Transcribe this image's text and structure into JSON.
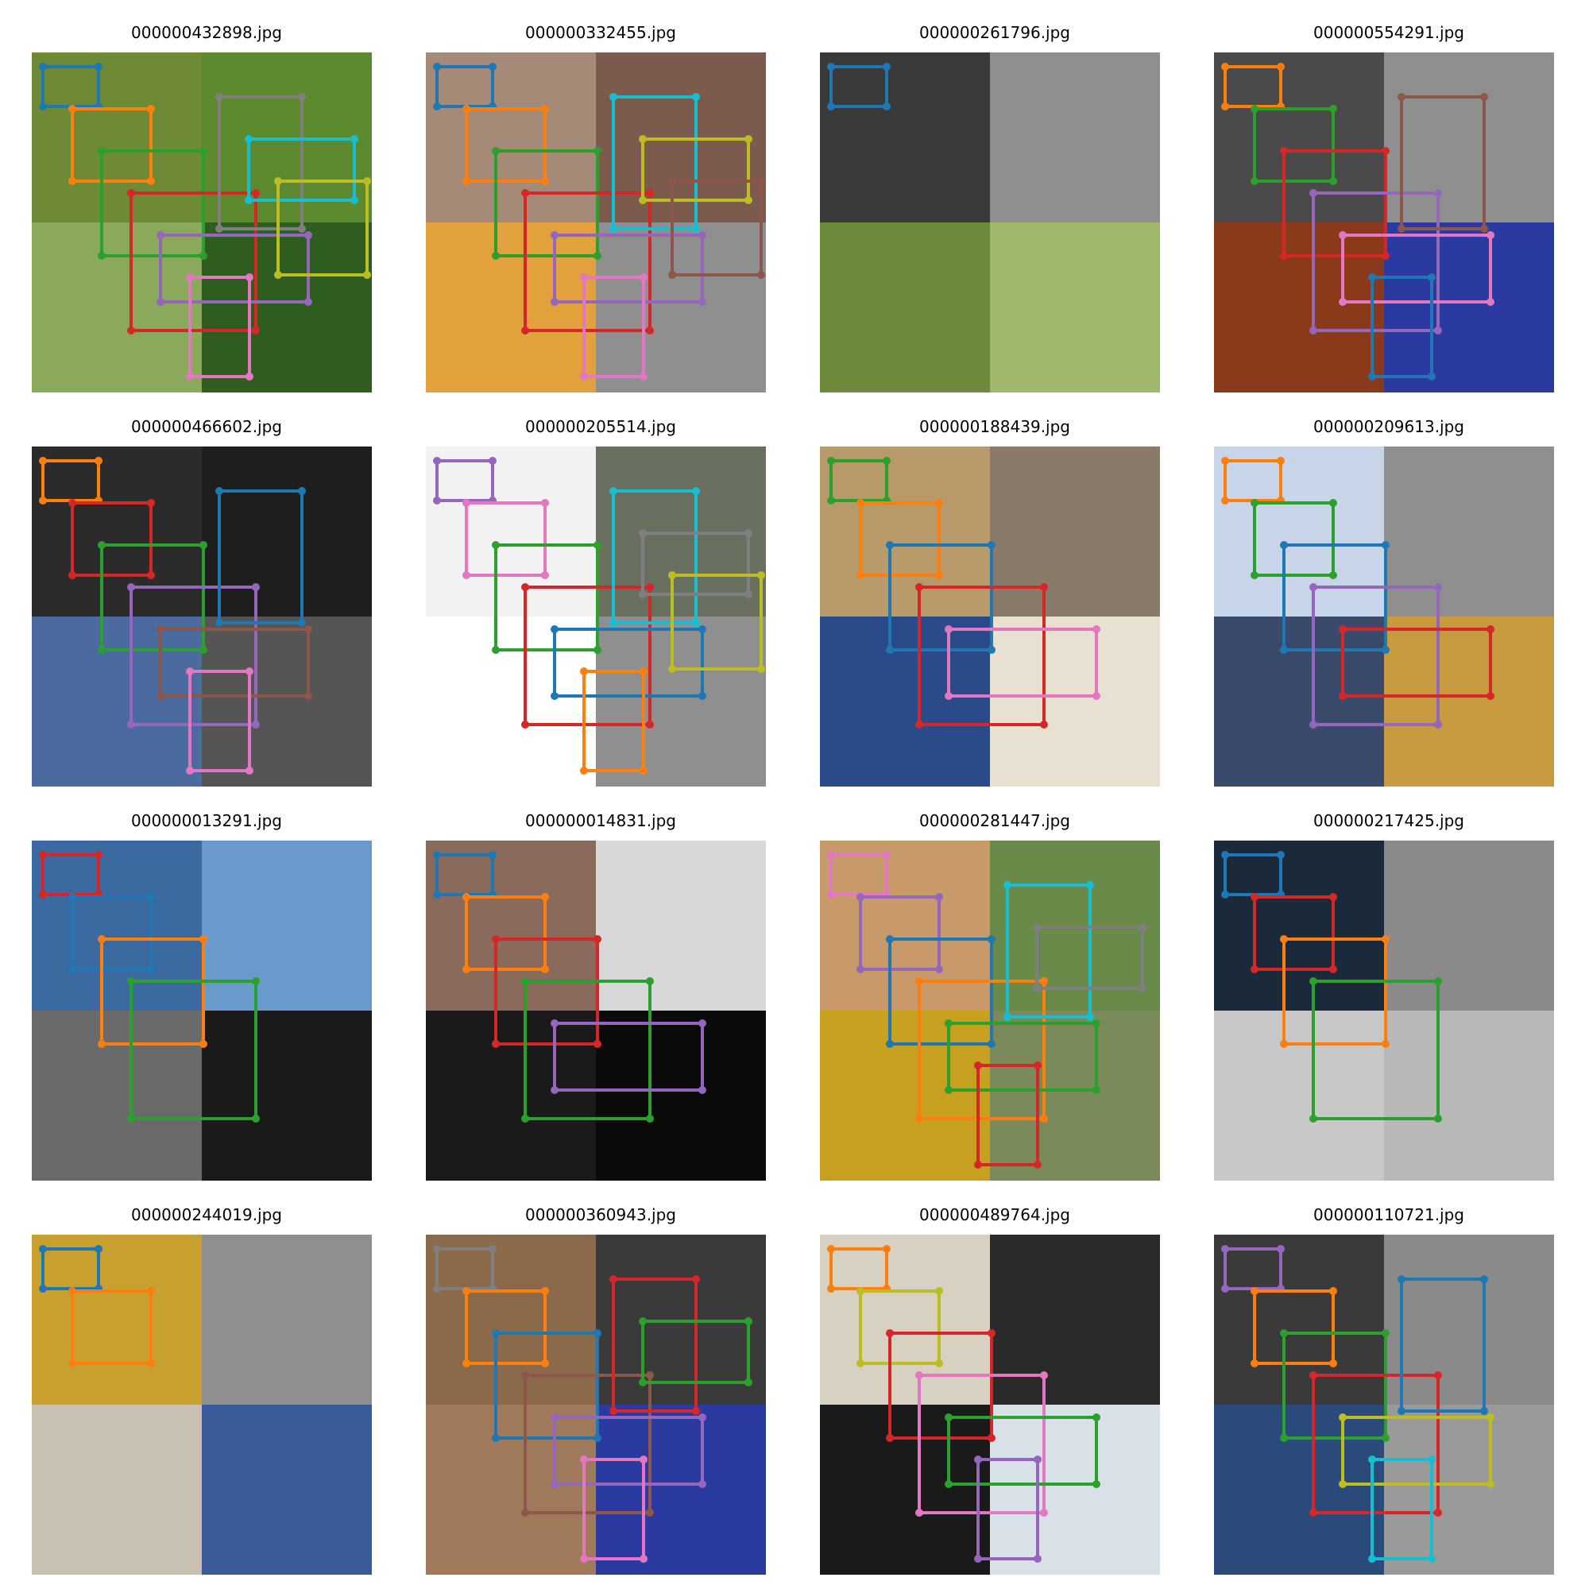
{
  "grid": {
    "images": [
      {
        "title": "000000432898.jpg",
        "tiles": [
          "#6f8a35",
          "#5d8a2e",
          "#8aa95a",
          "#2f5c1f"
        ],
        "boxes": [
          {
            "color": "#1f77b4"
          },
          {
            "color": "#ff7f0e"
          },
          {
            "color": "#2ca02c"
          },
          {
            "color": "#d62728"
          },
          {
            "color": "#9467bd"
          },
          {
            "color": "#e377c2"
          },
          {
            "color": "#7f7f7f"
          },
          {
            "color": "#17becf"
          },
          {
            "color": "#bcbd22"
          }
        ]
      },
      {
        "title": "000000332455.jpg",
        "tiles": [
          "#a58b77",
          "#7c5b4e",
          "#e2a13c",
          "#8f8f8f"
        ],
        "boxes": [
          {
            "color": "#1f77b4"
          },
          {
            "color": "#ff7f0e"
          },
          {
            "color": "#2ca02c"
          },
          {
            "color": "#d62728"
          },
          {
            "color": "#9467bd"
          },
          {
            "color": "#e377c2"
          },
          {
            "color": "#17becf"
          },
          {
            "color": "#bcbd22"
          },
          {
            "color": "#8c564b"
          }
        ]
      },
      {
        "title": "000000261796.jpg",
        "tiles": [
          "#3a3a3a",
          "#8f8f8f",
          "#6c8a3a",
          "#a0b86a"
        ],
        "boxes": [
          {
            "color": "#1f77b4"
          }
        ]
      },
      {
        "title": "000000554291.jpg",
        "tiles": [
          "#4a4a4a",
          "#8f8f8f",
          "#8a3a1a",
          "#2a3aa0"
        ],
        "boxes": [
          {
            "color": "#ff7f0e"
          },
          {
            "color": "#2ca02c"
          },
          {
            "color": "#d62728"
          },
          {
            "color": "#9467bd"
          },
          {
            "color": "#e377c2"
          },
          {
            "color": "#1f77b4"
          },
          {
            "color": "#8c564b"
          }
        ]
      },
      {
        "title": "000000466602.jpg",
        "tiles": [
          "#2b2b2b",
          "#1e1e1e",
          "#4a6aa0",
          "#555555"
        ],
        "boxes": [
          {
            "color": "#ff7f0e"
          },
          {
            "color": "#d62728"
          },
          {
            "color": "#2ca02c"
          },
          {
            "color": "#9467bd"
          },
          {
            "color": "#8c564b"
          },
          {
            "color": "#e377c2"
          },
          {
            "color": "#1f77b4"
          }
        ]
      },
      {
        "title": "000000205514.jpg",
        "tiles": [
          "#f2f2f2",
          "#6a7060",
          "#ffffff",
          "#8f8f8f"
        ],
        "boxes": [
          {
            "color": "#9467bd"
          },
          {
            "color": "#e377c2"
          },
          {
            "color": "#2ca02c"
          },
          {
            "color": "#d62728"
          },
          {
            "color": "#1f77b4"
          },
          {
            "color": "#ff7f0e"
          },
          {
            "color": "#17becf"
          },
          {
            "color": "#7f7f7f"
          },
          {
            "color": "#bcbd22"
          }
        ]
      },
      {
        "title": "000000188439.jpg",
        "tiles": [
          "#b89a6a",
          "#8a7a6a",
          "#2a4a8a",
          "#e8e0d0"
        ],
        "boxes": [
          {
            "color": "#2ca02c"
          },
          {
            "color": "#ff7f0e"
          },
          {
            "color": "#1f77b4"
          },
          {
            "color": "#d62728"
          },
          {
            "color": "#e377c2"
          }
        ]
      },
      {
        "title": "000000209613.jpg",
        "tiles": [
          "#c8d4e8",
          "#8f8f8f",
          "#3a4a6a",
          "#c89a40"
        ],
        "boxes": [
          {
            "color": "#ff7f0e"
          },
          {
            "color": "#2ca02c"
          },
          {
            "color": "#1f77b4"
          },
          {
            "color": "#9467bd"
          },
          {
            "color": "#d62728"
          }
        ]
      },
      {
        "title": "000000013291.jpg",
        "tiles": [
          "#3a6aa0",
          "#6a9acc",
          "#6a6a6a",
          "#1a1a1a"
        ],
        "boxes": [
          {
            "color": "#d62728"
          },
          {
            "color": "#1f77b4"
          },
          {
            "color": "#ff7f0e"
          },
          {
            "color": "#2ca02c"
          }
        ]
      },
      {
        "title": "000000014831.jpg",
        "tiles": [
          "#8a6a5a",
          "#d8d8d8",
          "#1a1a1a",
          "#0a0a0a"
        ],
        "boxes": [
          {
            "color": "#1f77b4"
          },
          {
            "color": "#ff7f0e"
          },
          {
            "color": "#d62728"
          },
          {
            "color": "#2ca02c"
          },
          {
            "color": "#9467bd"
          }
        ]
      },
      {
        "title": "000000281447.jpg",
        "tiles": [
          "#c89a6a",
          "#6a8a4a",
          "#c8a020",
          "#7a8a5a"
        ],
        "boxes": [
          {
            "color": "#e377c2"
          },
          {
            "color": "#9467bd"
          },
          {
            "color": "#1f77b4"
          },
          {
            "color": "#ff7f0e"
          },
          {
            "color": "#2ca02c"
          },
          {
            "color": "#d62728"
          },
          {
            "color": "#17becf"
          },
          {
            "color": "#7f7f7f"
          }
        ]
      },
      {
        "title": "000000217425.jpg",
        "tiles": [
          "#1a2a3a",
          "#8a8a8a",
          "#c8c8c8",
          "#b8b8b8"
        ],
        "boxes": [
          {
            "color": "#1f77b4"
          },
          {
            "color": "#d62728"
          },
          {
            "color": "#ff7f0e"
          },
          {
            "color": "#2ca02c"
          }
        ]
      },
      {
        "title": "000000244019.jpg",
        "tiles": [
          "#c8a030",
          "#8f8f8f",
          "#c8c0b0",
          "#3a5a9a"
        ],
        "boxes": [
          {
            "color": "#1f77b4"
          },
          {
            "color": "#ff7f0e"
          }
        ]
      },
      {
        "title": "000000360943.jpg",
        "tiles": [
          "#8a6a4a",
          "#3a3a3a",
          "#a07a5a",
          "#2a3aa0"
        ],
        "boxes": [
          {
            "color": "#7f7f7f"
          },
          {
            "color": "#ff7f0e"
          },
          {
            "color": "#1f77b4"
          },
          {
            "color": "#8c564b"
          },
          {
            "color": "#9467bd"
          },
          {
            "color": "#e377c2"
          },
          {
            "color": "#d62728"
          },
          {
            "color": "#2ca02c"
          }
        ]
      },
      {
        "title": "000000489764.jpg",
        "tiles": [
          "#d8d0c0",
          "#2a2a2a",
          "#1a1a1a",
          "#d8e0e8"
        ],
        "boxes": [
          {
            "color": "#ff7f0e"
          },
          {
            "color": "#bcbd22"
          },
          {
            "color": "#d62728"
          },
          {
            "color": "#e377c2"
          },
          {
            "color": "#2ca02c"
          },
          {
            "color": "#9467bd"
          }
        ]
      },
      {
        "title": "000000110721.jpg",
        "tiles": [
          "#3a3a3a",
          "#8a8a8a",
          "#2a4a7a",
          "#9a9a9a"
        ],
        "boxes": [
          {
            "color": "#9467bd"
          },
          {
            "color": "#ff7f0e"
          },
          {
            "color": "#2ca02c"
          },
          {
            "color": "#d62728"
          },
          {
            "color": "#bcbd22"
          },
          {
            "color": "#17becf"
          },
          {
            "color": "#1f77b4"
          }
        ]
      }
    ]
  }
}
